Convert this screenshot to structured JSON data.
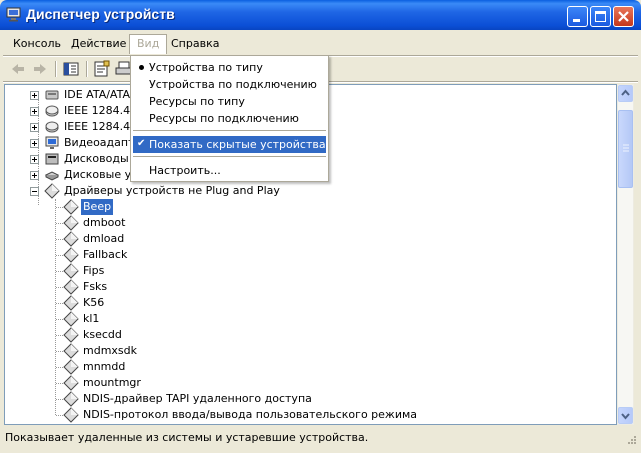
{
  "window": {
    "title": "Диспетчер устройств",
    "icon": "device-manager-icon"
  },
  "menubar": {
    "items": [
      {
        "label": "Консоль"
      },
      {
        "label": "Действие"
      },
      {
        "label": "Вид"
      },
      {
        "label": "Справка"
      }
    ],
    "active_index": 2
  },
  "view_menu": {
    "items": [
      {
        "label": "Устройства по типу",
        "state": "radio-selected"
      },
      {
        "label": "Устройства по подключению",
        "state": "none"
      },
      {
        "label": "Ресурсы по типу",
        "state": "none"
      },
      {
        "label": "Ресурсы по подключению",
        "state": "none"
      },
      {
        "label": "Показать скрытые устройства",
        "state": "checked",
        "highlighted": true
      },
      {
        "label": "Настроить...",
        "state": "none"
      }
    ]
  },
  "tree": {
    "categories": [
      {
        "label": "IDE ATA/ATA",
        "icon": "ide-controller-icon"
      },
      {
        "label": "IEEE 1284.4 с",
        "icon": "ieee-device-icon"
      },
      {
        "label": "IEEE 1284.4 у",
        "icon": "ieee-device-icon"
      },
      {
        "label": "Видеоадапте",
        "icon": "display-adapter-icon"
      },
      {
        "label": "Дисководы г",
        "icon": "floppy-drive-icon"
      },
      {
        "label": "Дисковые ус",
        "icon": "disk-drive-icon"
      },
      {
        "label": "Драйверы устройств не Plug and Play",
        "icon": "non-pnp-driver-icon"
      }
    ],
    "drivers": [
      {
        "label": "Beep",
        "selected": true
      },
      {
        "label": "dmboot"
      },
      {
        "label": "dmload"
      },
      {
        "label": "Fallback"
      },
      {
        "label": "Fips"
      },
      {
        "label": "Fsks"
      },
      {
        "label": "K56"
      },
      {
        "label": "kl1"
      },
      {
        "label": "ksecdd"
      },
      {
        "label": "mdmxsdk"
      },
      {
        "label": "mnmdd"
      },
      {
        "label": "mountmgr"
      },
      {
        "label": "NDIS-драйвер TAPI удаленного доступа"
      },
      {
        "label": "NDIS-протокол ввода/вывода пользовательского режима"
      }
    ]
  },
  "statusbar": {
    "text": "Показывает удаленные из системы и устаревшие устройства."
  },
  "colors": {
    "selection": "#316AC5",
    "titlebar": "#0B4FD6",
    "chrome": "#ECE9D8"
  }
}
